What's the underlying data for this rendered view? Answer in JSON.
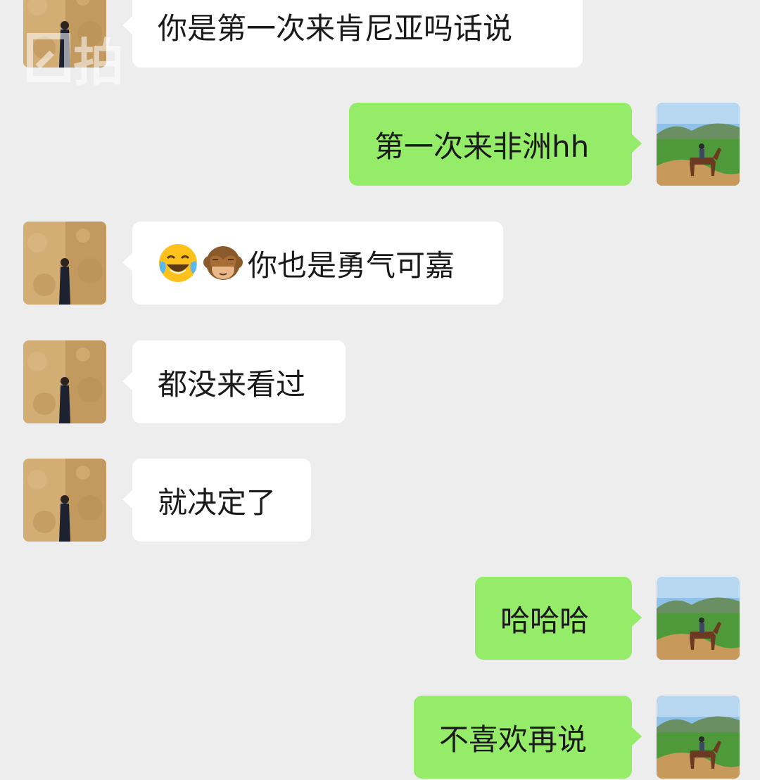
{
  "watermark": {
    "text": "拍"
  },
  "messages": [
    {
      "side": "in",
      "text": "你是第一次来肯尼亚吗话说",
      "emojis": []
    },
    {
      "side": "out",
      "text": "第一次来非洲hh",
      "emojis": []
    },
    {
      "side": "in",
      "text": "你也是勇气可嘉",
      "emojis": [
        "tears-of-joy-emoji",
        "see-no-evil-monkey-emoji"
      ]
    },
    {
      "side": "in",
      "text": "都没来看过",
      "emojis": []
    },
    {
      "side": "in",
      "text": "就决定了",
      "emojis": []
    },
    {
      "side": "out",
      "text": "哈哈哈",
      "emojis": []
    },
    {
      "side": "out",
      "text": "不喜欢再说",
      "emojis": []
    }
  ],
  "avatars": {
    "in": "woman-against-wall-avatar",
    "out": "horse-rider-landscape-avatar"
  },
  "colors": {
    "background": "#ededed",
    "incoming_bubble": "#ffffff",
    "outgoing_bubble": "#95ec69",
    "text": "#1a1a1a"
  }
}
